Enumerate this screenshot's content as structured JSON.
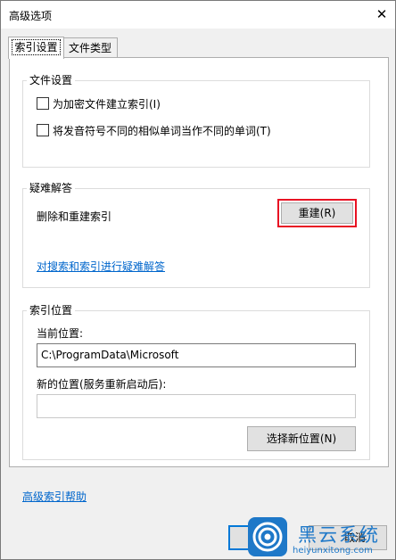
{
  "window": {
    "title": "高级选项"
  },
  "tabs": [
    {
      "label": "索引设置",
      "active": true
    },
    {
      "label": "文件类型",
      "active": false
    }
  ],
  "file_settings": {
    "legend": "文件设置",
    "options": [
      {
        "label": "为加密文件建立索引(I)",
        "checked": false
      },
      {
        "label": "将发音符号不同的相似单词当作不同的单词(T)",
        "checked": false
      }
    ]
  },
  "troubleshoot": {
    "legend": "疑难解答",
    "description": "删除和重建索引",
    "rebuild_label": "重建(R)",
    "link": "对搜索和索引进行疑难解答"
  },
  "index_location": {
    "legend": "索引位置",
    "current_label": "当前位置:",
    "current_value": "C:\\ProgramData\\Microsoft",
    "new_label": "新的位置(服务重新启动后):",
    "new_value": "",
    "select_label": "选择新位置(N)"
  },
  "help_link": "高级索引帮助",
  "footer": {
    "cancel_label": "取消"
  },
  "watermark": {
    "name": "黑云系统",
    "url": "heiyunxitong.com"
  },
  "colors": {
    "highlight": "#e81123",
    "link": "#0066cc",
    "accent": "#0078d7",
    "watermark": "#1e78c8"
  }
}
